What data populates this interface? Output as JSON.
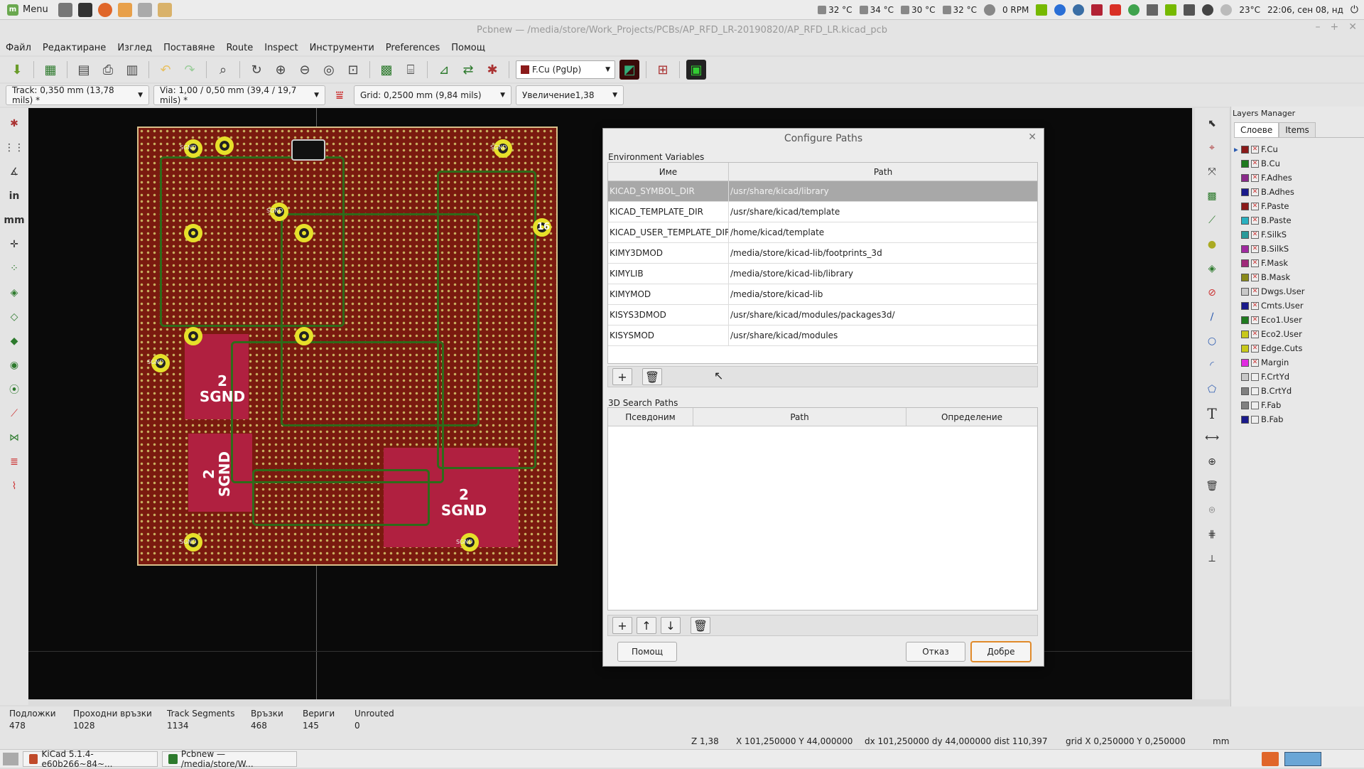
{
  "system": {
    "menu_label": "Menu",
    "temps": [
      "32 °C",
      "34 °C",
      "30 °C",
      "32 °C"
    ],
    "fan": "0 RPM",
    "weather": "23°C",
    "clock": "22:06, сен 08, нд"
  },
  "window": {
    "title": "Pcbnew — /media/store/Work_Projects/PCBs/AP_RFD_LR-20190820/AP_RFD_LR.kicad_pcb"
  },
  "menubar": [
    "Файл",
    "Редактиране",
    "Изглед",
    "Поставяне",
    "Route",
    "Inspect",
    "Инструменти",
    "Preferences",
    "Помощ"
  ],
  "toolbar": {
    "active_layer": "F.Cu (PgUp)",
    "active_layer_color": "#8b1a1a"
  },
  "toolbar2": {
    "track": "Track: 0,350 mm (13,78 mils) *",
    "via": "Via: 1,00 / 0,50 mm (39,4 / 19,7 mils) *",
    "grid": "Grid: 0,2500 mm (9,84 mils)",
    "zoom": "Увеличение1,38"
  },
  "left_toolbar": {
    "inch_label": "in",
    "mm_label": "mm"
  },
  "pcb": {
    "pad_labels": [
      {
        "n": "2",
        "t": "SGND"
      },
      {
        "n": "2",
        "t": "SGND"
      },
      {
        "n": "2",
        "t": "SGND"
      }
    ],
    "small_labels": [
      "SGND",
      "SGND",
      "SGND",
      "SGND",
      "SGND",
      "SGND"
    ],
    "pin_number": "16"
  },
  "dialog": {
    "title": "Configure Paths",
    "env_section": "Environment Variables",
    "env_headers": [
      "Име",
      "Path"
    ],
    "env_rows": [
      {
        "name": "KICAD_SYMBOL_DIR",
        "path": "/usr/share/kicad/library"
      },
      {
        "name": "KICAD_TEMPLATE_DIR",
        "path": "/usr/share/kicad/template"
      },
      {
        "name": "KICAD_USER_TEMPLATE_DIR",
        "path": "/home/kicad/template"
      },
      {
        "name": "KIMY3DMOD",
        "path": "/media/store/kicad-lib/footprints_3d"
      },
      {
        "name": "KIMYLIB",
        "path": "/media/store/kicad-lib/library"
      },
      {
        "name": "KIMYMOD",
        "path": "/media/store/kicad-lib"
      },
      {
        "name": "KISYS3DMOD",
        "path": "/usr/share/kicad/modules/packages3d/"
      },
      {
        "name": "KISYSMOD",
        "path": "/usr/share/kicad/modules"
      }
    ],
    "search_section": "3D Search Paths",
    "search_headers": [
      "Псевдоним",
      "Path",
      "Определение"
    ],
    "help": "Помощ",
    "cancel": "Отказ",
    "ok": "Добре"
  },
  "layers_manager": {
    "title": "Layers Manager",
    "tabs": [
      "Слоеве",
      "Items"
    ],
    "layers": [
      {
        "name": "F.Cu",
        "color": "#8b1a1a"
      },
      {
        "name": "B.Cu",
        "color": "#1f7a1f"
      },
      {
        "name": "F.Adhes",
        "color": "#8a2a8a"
      },
      {
        "name": "B.Adhes",
        "color": "#1a1a8b"
      },
      {
        "name": "F.Paste",
        "color": "#8b1a1a"
      },
      {
        "name": "B.Paste",
        "color": "#2ab0c0"
      },
      {
        "name": "F.SilkS",
        "color": "#2a9a9a"
      },
      {
        "name": "B.SilkS",
        "color": "#a02aa0"
      },
      {
        "name": "F.Mask",
        "color": "#a02a7a"
      },
      {
        "name": "B.Mask",
        "color": "#8a8a1a"
      },
      {
        "name": "Dwgs.User",
        "color": "#c8c8c8"
      },
      {
        "name": "Cmts.User",
        "color": "#1a1a8b"
      },
      {
        "name": "Eco1.User",
        "color": "#1f7a1f"
      },
      {
        "name": "Eco2.User",
        "color": "#c8c81a"
      },
      {
        "name": "Edge.Cuts",
        "color": "#c8c81a"
      },
      {
        "name": "Margin",
        "color": "#e02ae0"
      },
      {
        "name": "F.CrtYd",
        "color": "#c8c8c8"
      },
      {
        "name": "B.CrtYd",
        "color": "#808080"
      },
      {
        "name": "F.Fab",
        "color": "#808080"
      },
      {
        "name": "B.Fab",
        "color": "#1a1a8b"
      }
    ]
  },
  "status": {
    "items": [
      {
        "label": "Подложки",
        "value": "478"
      },
      {
        "label": "Проходни връзки",
        "value": "1028"
      },
      {
        "label": "Track Segments",
        "value": "1134"
      },
      {
        "label": "Връзки",
        "value": "468"
      },
      {
        "label": "Вериги",
        "value": "145"
      },
      {
        "label": "Unrouted",
        "value": "0"
      }
    ],
    "zoom": "Z 1,38",
    "xy": "X 101,250000  Y 44,000000",
    "delta": "dx 101,250000  dy 44,000000  dist 110,397",
    "grid": "grid X 0,250000  Y 0,250000",
    "units": "mm"
  },
  "taskbar": {
    "tasks": [
      "KiCad 5.1.4-e60b266~84~...",
      "Pcbnew — /media/store/W..."
    ]
  }
}
